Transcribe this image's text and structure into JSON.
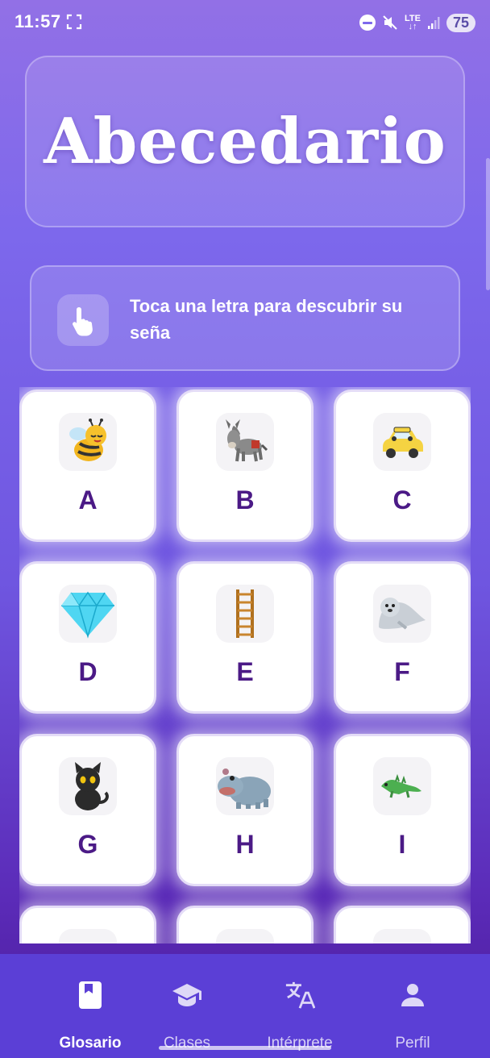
{
  "status": {
    "time": "11:57",
    "network": "LTE",
    "battery": "75"
  },
  "header": {
    "title": "Abecedario"
  },
  "hint": {
    "text": "Toca una letra para descubrir su seña",
    "icon": "tap-hand-icon"
  },
  "letters": [
    {
      "letter": "A",
      "picture": "bee"
    },
    {
      "letter": "B",
      "picture": "donkey"
    },
    {
      "letter": "C",
      "picture": "car"
    },
    {
      "letter": "D",
      "picture": "diamond"
    },
    {
      "letter": "E",
      "picture": "ladder"
    },
    {
      "letter": "F",
      "picture": "seal"
    },
    {
      "letter": "G",
      "picture": "cat"
    },
    {
      "letter": "H",
      "picture": "hippo"
    },
    {
      "letter": "I",
      "picture": "iguana"
    },
    {
      "letter": "",
      "picture": "partial"
    },
    {
      "letter": "",
      "picture": "partial"
    },
    {
      "letter": "",
      "picture": "partial"
    }
  ],
  "nav": {
    "items": [
      {
        "label": "Glosario",
        "icon": "book-icon",
        "active": true
      },
      {
        "label": "Clases",
        "icon": "graduation-cap-icon",
        "active": false
      },
      {
        "label": "Intérprete",
        "icon": "translate-icon",
        "active": false
      },
      {
        "label": "Perfil",
        "icon": "person-icon",
        "active": false
      }
    ]
  },
  "colors": {
    "letter": "#4b1a86",
    "nav_bg": "#5b3fd6"
  }
}
